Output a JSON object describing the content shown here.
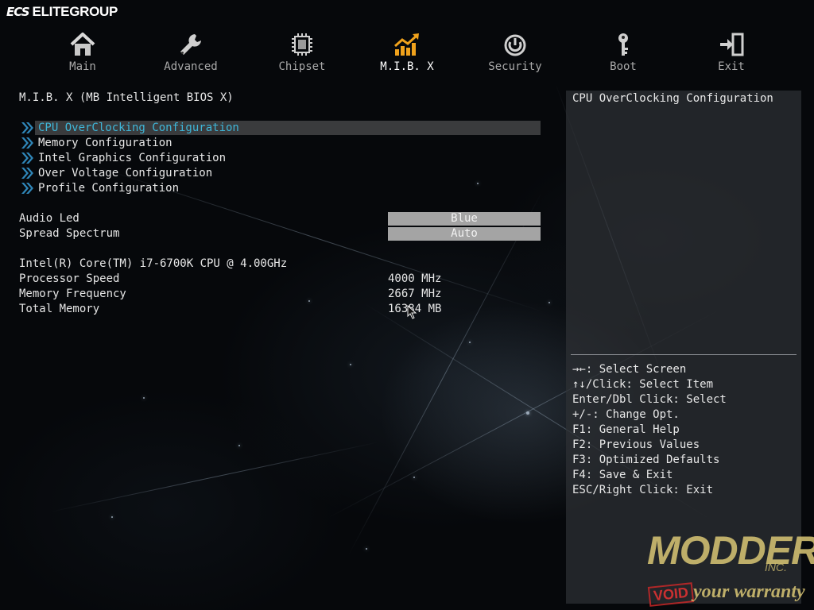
{
  "brand": {
    "mark": "ECS",
    "name": "ELITEGROUP"
  },
  "nav": {
    "tabs": [
      {
        "label": "Main",
        "icon": "home-icon"
      },
      {
        "label": "Advanced",
        "icon": "wrench-icon"
      },
      {
        "label": "Chipset",
        "icon": "chip-icon"
      },
      {
        "label": "M.I.B. X",
        "icon": "performance-chart-icon",
        "active": true
      },
      {
        "label": "Security",
        "icon": "power-lock-icon"
      },
      {
        "label": "Boot",
        "icon": "key-icon"
      },
      {
        "label": "Exit",
        "icon": "exit-door-icon"
      }
    ]
  },
  "main": {
    "title": "M.I.B. X (MB Intelligent BIOS X)",
    "submenus": [
      {
        "label": "CPU OverClocking Configuration",
        "selected": true
      },
      {
        "label": "Memory Configuration"
      },
      {
        "label": "Intel Graphics Configuration"
      },
      {
        "label": "Over Voltage Configuration"
      },
      {
        "label": "Profile Configuration"
      }
    ],
    "options": [
      {
        "label": "Audio Led",
        "value": "Blue"
      },
      {
        "label": "Spread Spectrum",
        "value": "Auto"
      }
    ],
    "cpu_name": "Intel(R) Core(TM) i7-6700K CPU @ 4.00GHz",
    "info": [
      {
        "label": "Processor Speed",
        "value": "4000 MHz"
      },
      {
        "label": "Memory Frequency",
        "value": "2667 MHz"
      },
      {
        "label": "Total Memory",
        "value": "16384 MB"
      }
    ]
  },
  "help": {
    "title": "CPU OverClocking Configuration",
    "keys": [
      "→←: Select Screen",
      "↑↓/Click: Select Item",
      "Enter/Dbl Click: Select",
      "+/-: Change Opt.",
      "F1: General Help",
      "F2: Previous Values",
      "F3: Optimized Defaults",
      "F4: Save & Exit",
      "ESC/Right Click: Exit"
    ]
  },
  "watermark": {
    "brand": "MODDERS",
    "suffix": "INC.",
    "stamp": "VOID",
    "tagline": "your warranty"
  },
  "colors": {
    "selected_text": "#3fb6d8",
    "chevron": "#2f86b8",
    "option_bg": "#a4a4a4",
    "watermark": "#e1cd78",
    "stamp": "#dc3232"
  }
}
